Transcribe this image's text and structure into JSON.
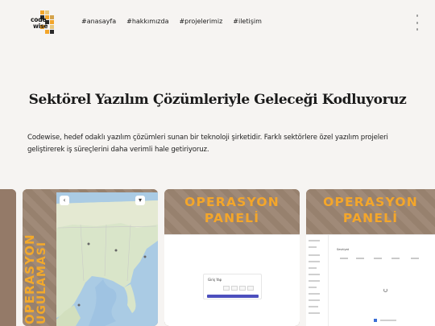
{
  "brand": {
    "logo_line1": "code",
    "logo_line2": "wise",
    "accent": "#f3a52a"
  },
  "nav": {
    "items": [
      "#anasayfa",
      "#hakkımızda",
      "#projelerimiz",
      "#iletişim"
    ]
  },
  "hero": {
    "title": "Sektörel Yazılım Çözümleriyle Geleceği Kodluyoruz",
    "description": "Codewise, hedef odaklı yazılım çözümleri sunan bir teknoloji şirketidir. Farklı sektörlere özel yazılım projeleri geliştirerek iş süreçlerini daha verimli hale getiriyoruz."
  },
  "projects": [
    {
      "title_line1": "OPERASYON",
      "title_line2": "UYGULAMASI",
      "title_line2_visible": "UGULAMASI"
    },
    {
      "title_line1": "OPERASYON",
      "title_line2": "PANELİ",
      "login_title": "Giriş Yap"
    },
    {
      "title_line1": "OPERASYON",
      "title_line2": "PANELİ",
      "page_heading": "Sevkiyat"
    }
  ],
  "colors": {
    "background": "#f6f4f2",
    "card": "#9c8572",
    "panel_title": "#f4a62a",
    "button": "#4c4fbd"
  }
}
